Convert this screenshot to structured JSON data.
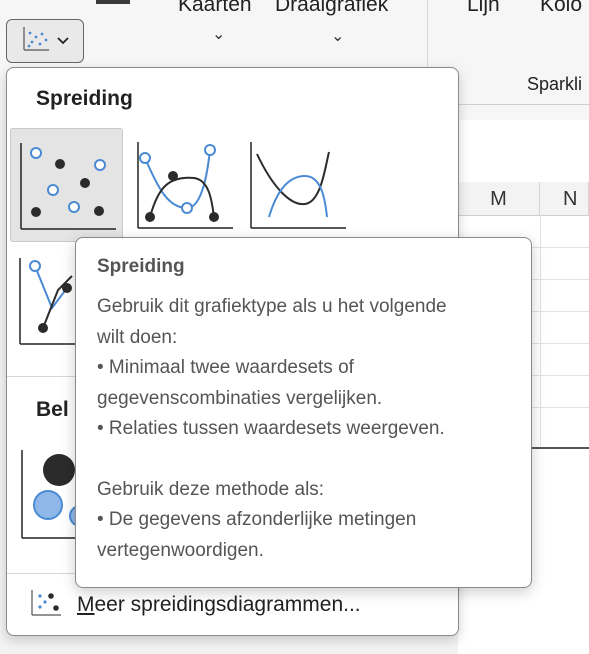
{
  "ribbon": {
    "kaarten_label": "Kaarten",
    "draaigrafiek_label": "Draaigrafiek",
    "lijn_label": "Lijn",
    "kolom_label": "Kolo",
    "sparklines_label": "Sparkli"
  },
  "sheet": {
    "columns": [
      "M",
      "N"
    ]
  },
  "menu": {
    "section_scatter": "Spreiding",
    "section_bubble": "Bel",
    "more_label_accel": "M",
    "more_label_rest": "eer spreidingsdiagrammen..."
  },
  "tooltip": {
    "title": "Spreiding",
    "line1": "Gebruik dit grafiektype als u het volgende",
    "line2": "wilt doen:",
    "line3": "• Minimaal twee waardesets of",
    "line4": "gegevenscombinaties vergelijken.",
    "line5": "• Relaties tussen waardesets weergeven.",
    "line6": "Gebruik deze methode als:",
    "line7": "• De gegevens afzonderlijke metingen",
    "line8": "vertegenwoordigen."
  },
  "colors": {
    "accent_blue": "#4a8ad4",
    "dark_point": "#2b2b2b",
    "bubble_fill": "#8fb8e8"
  }
}
